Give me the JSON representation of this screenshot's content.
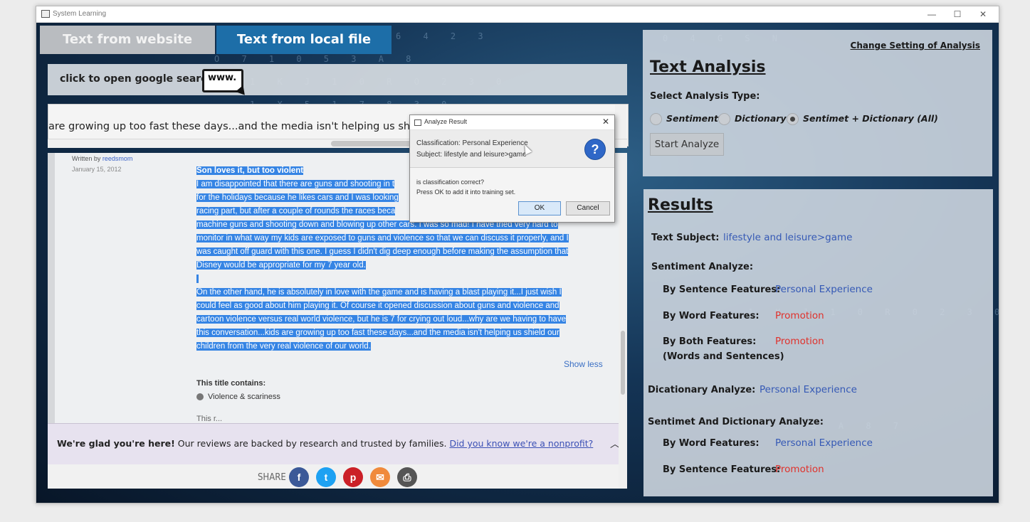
{
  "window": {
    "title": "System Learning",
    "controls": [
      "—",
      "☐",
      "✕"
    ]
  },
  "tabs": [
    {
      "label": "Text from website"
    },
    {
      "label": "Text from local file"
    }
  ],
  "google_bar": {
    "label": "click to open google search",
    "icon_text": "www."
  },
  "scroll_text": "are growing up too fast these days...and the media isn't helping us shield our chil",
  "webpage": {
    "author_prefix": "Written by ",
    "author": "reedsmom",
    "date": "January 15, 2012",
    "review_title": "Son loves it, but too violent",
    "para1_lines": [
      "I am disappointed that there are guns and shooting in t",
      "for the holidays because he likes cars and I was looking",
      "racing part, but after a couple of rounds the races beca",
      "machine guns and shooting down and blowing up other cars. I was so mad! I have tried very hard to",
      "monitor in what way my kids are exposed to guns and violence so that we can discuss it properly, and I",
      "was caught off guard with this one. I guess I didn't dig deep enough before making the assumption that",
      "Disney would be appropriate for my 7 year old."
    ],
    "para2_lines": [
      "On the other hand, he is absolutely in love with the game and is having a blast playing it...I just wish I",
      "could feel as good about him playing it. Of course it opened discussion about guns and violence and",
      "cartoon violence versus real world violence, but he is 7 for crying out loud...why are we having to have",
      "this conversation...kids are growing up too fast these days...and the media isn't helping us shield our",
      "children from the very real violence of our world."
    ],
    "show_less": "Show less",
    "contains_title": "This title contains:",
    "contains_item": "Violence & scariness",
    "cut_text": "This r...",
    "banner_bold": "We're glad you're here!",
    "banner_text": " Our reviews are backed by research and trusted by families. ",
    "banner_link": "Did you know we're a nonprofit?",
    "share_label": "SHARE",
    "share_icons": [
      {
        "name": "facebook-icon",
        "glyph": "f",
        "color": "#3b5998"
      },
      {
        "name": "twitter-icon",
        "glyph": "t",
        "color": "#1da1f2"
      },
      {
        "name": "pinterest-icon",
        "glyph": "p",
        "color": "#cb2027"
      },
      {
        "name": "email-icon",
        "glyph": "✉",
        "color": "#f08a3c"
      },
      {
        "name": "print-icon",
        "glyph": "⎙",
        "color": "#555555"
      }
    ]
  },
  "analysis": {
    "change_link": "Change Setting of Analysis",
    "heading": "Text Analysis",
    "select_label": "Select Analysis Type:",
    "options": [
      "Sentiment",
      "Dictionary",
      "Sentimet + Dictionary (All)"
    ],
    "selected_option": "Sentimet + Dictionary (All)",
    "start_button": "Start Analyze"
  },
  "results": {
    "heading": "Results",
    "text_subject_label": "Text Subject:",
    "text_subject_value": "lifestyle and leisure>game",
    "sentiment_label": "Sentiment Analyze:",
    "by_sentence_label": "By Sentence Features:",
    "by_sentence_value": "Personal Experience",
    "by_word_label": "By Word Features:",
    "by_word_value": "Promotion",
    "by_both_label": "By Both Features:",
    "by_both_sub": "(Words and Sentences)",
    "by_both_value": "Promotion",
    "dictionary_label": "Dicationary Analyze:",
    "dictionary_value": "Personal Experience",
    "combined_label": "Sentimet And Dictionary Analyze:",
    "combined_word_label": "By Word Features:",
    "combined_word_value": "Personal Experience",
    "combined_sentence_label": "By Sentence Features:",
    "combined_sentence_value": "Promotion",
    "colors": {
      "blue": "#3559b5",
      "red": "#e0312b"
    }
  },
  "dialog": {
    "title": "Analyze Result",
    "classification": "Classification: Personal Experience",
    "subject": "Subject: lifestyle and leisure>game",
    "question": "is classification correct?",
    "instruction": "Press OK to add it into training set.",
    "ok": "OK",
    "cancel": "Cancel"
  }
}
